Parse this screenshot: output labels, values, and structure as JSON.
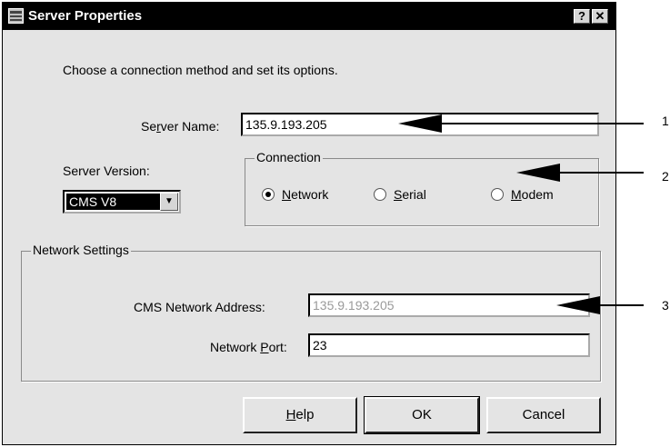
{
  "window": {
    "title": "Server Properties",
    "help_btn": "?",
    "close_btn": "✕"
  },
  "instructions": "Choose a connection method and set its options.",
  "server_name": {
    "label_pre": "Se",
    "label_ul": "r",
    "label_post": "ver Name:",
    "value": "135.9.193.205"
  },
  "server_version": {
    "label": "Server Version:",
    "selected": "CMS V8",
    "arrow": "▼"
  },
  "connection": {
    "title": "Connection",
    "options": [
      {
        "ul": "N",
        "rest": "etwork",
        "selected": true
      },
      {
        "ul": "S",
        "rest": "erial",
        "selected": false
      },
      {
        "ul": "M",
        "rest": "odem",
        "selected": false
      }
    ]
  },
  "network_settings": {
    "title": "Network Settings",
    "address_label": "CMS Network Address:",
    "address_value": "135.9.193.205",
    "port_label_pre": "Network ",
    "port_label_ul": "P",
    "port_label_post": "ort:",
    "port_value": "23"
  },
  "buttons": {
    "help_ul": "H",
    "help_rest": "elp",
    "ok": "OK",
    "cancel": "Cancel"
  },
  "callouts": [
    "1",
    "2",
    "3"
  ]
}
